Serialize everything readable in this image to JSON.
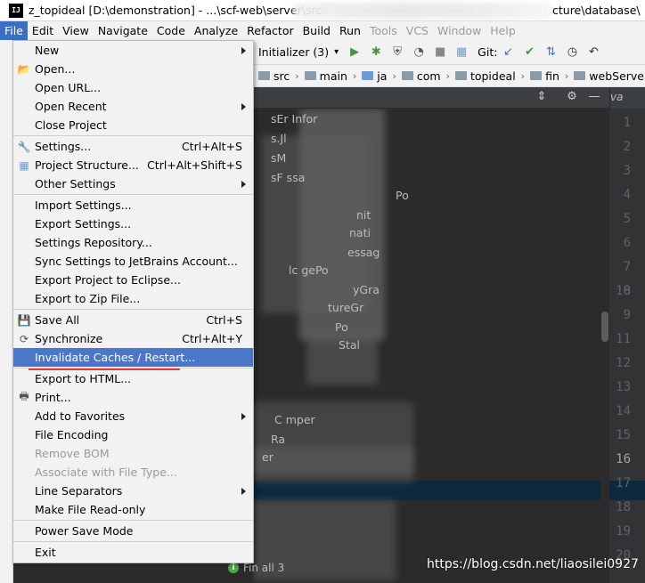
{
  "window": {
    "title_left": "z_topideal [D:\\demonstration] - ...\\scf-web\\server\\src",
    "title_right": "cture\\database\\"
  },
  "menubar": {
    "items": [
      "File",
      "Edit",
      "View",
      "Navigate",
      "Code",
      "Analyze",
      "Refactor",
      "Build",
      "Run",
      "Tools",
      "VCS",
      "Window",
      "Help"
    ]
  },
  "toolbar": {
    "run_config": "Initializer (3)",
    "git_label": "Git:"
  },
  "breadcrumb": [
    "src",
    "main",
    "ja",
    "com",
    "topideal",
    "fin",
    "webServer"
  ],
  "editor_tab": "va",
  "gutter": [
    "1",
    "2",
    "3",
    "4",
    "5",
    "6",
    "7",
    "8",
    "9",
    "10",
    "11",
    "12",
    "13",
    "14",
    "15",
    "16",
    "17",
    "18",
    "19",
    "20"
  ],
  "tree_fragments": {
    "r0": "sEr      Infor",
    "r1": "s.Jl",
    "r2": "sM",
    "r3": "sF             ssa",
    "r4": "Po",
    "r5": "nit",
    "r6": "nati",
    "r7": "essag",
    "r8": "lc      gePo",
    "r9": "yGra",
    "r10": "tureGr",
    "r11": "Po",
    "r12": "Stal",
    "r13": "C                            mper",
    "r14": "Ra",
    "r15": "er",
    "status_item": "Fin      all         3"
  },
  "menu": {
    "items": {
      "new": "New",
      "open": "Open...",
      "open_url": "Open URL...",
      "open_recent": "Open Recent",
      "close_project": "Close Project",
      "settings": "Settings...",
      "settings_sc": "Ctrl+Alt+S",
      "project_structure": "Project Structure...",
      "project_structure_sc": "Ctrl+Alt+Shift+S",
      "other_settings": "Other Settings",
      "import_settings": "Import Settings...",
      "export_settings": "Export Settings...",
      "settings_repository": "Settings Repository...",
      "sync_settings": "Sync Settings to JetBrains Account...",
      "export_eclipse": "Export Project to Eclipse...",
      "export_zip": "Export to Zip File...",
      "save_all": "Save All",
      "save_all_sc": "Ctrl+S",
      "synchronize": "Synchronize",
      "synchronize_sc": "Ctrl+Alt+Y",
      "invalidate_caches": "Invalidate Caches / Restart...",
      "export_html": "Export to HTML...",
      "print": "Print...",
      "add_favorites": "Add to Favorites",
      "file_encoding": "File Encoding",
      "remove_bom": "Remove BOM",
      "associate_file_type": "Associate with File Type...",
      "line_separators": "Line Separators",
      "make_read_only": "Make File Read-only",
      "power_save": "Power Save Mode",
      "exit": "Exit"
    }
  },
  "watermark": "https://blog.csdn.net/liaosilei0927",
  "colors": {
    "menu_highlight": "#4a77c8",
    "menubar_active": "#3b6fc3",
    "annotation_red": "#e53935",
    "tree_background": "#2b2b2b"
  }
}
